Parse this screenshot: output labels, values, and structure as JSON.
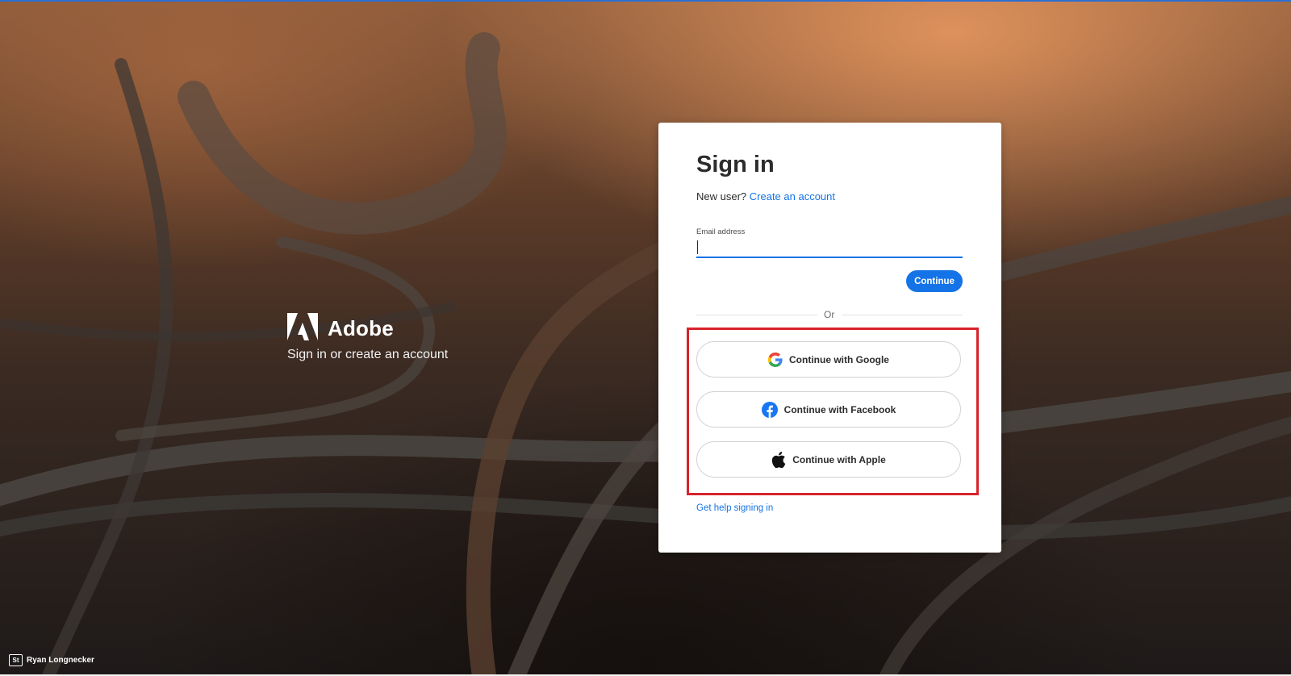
{
  "brand": {
    "name": "Adobe",
    "tagline": "Sign in or create an account"
  },
  "signin": {
    "title": "Sign in",
    "new_user_prompt": "New user?",
    "create_account_link": "Create an account",
    "email_label": "Email address",
    "email_value": "",
    "continue_label": "Continue",
    "divider_text": "Or",
    "social": [
      {
        "label": "Continue with Google",
        "icon": "google-icon"
      },
      {
        "label": "Continue with Facebook",
        "icon": "facebook-icon"
      },
      {
        "label": "Continue with Apple",
        "icon": "apple-icon"
      }
    ],
    "help_link": "Get help signing in"
  },
  "credit": {
    "badge": "St",
    "author": "Ryan Longnecker"
  },
  "colors": {
    "accent": "#1473e6",
    "highlight": "#d7232b",
    "facebook": "#1877f2"
  }
}
